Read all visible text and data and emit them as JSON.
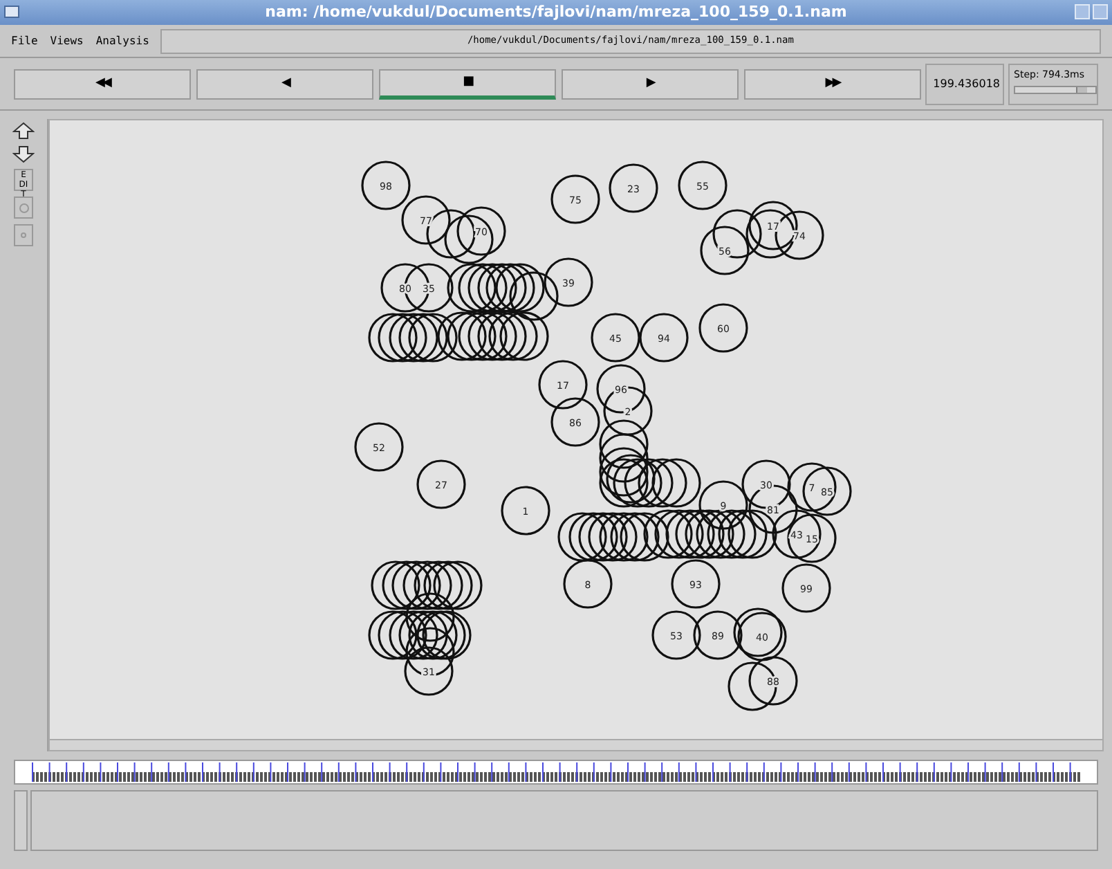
{
  "window": {
    "title": "nam: /home/vukdul/Documents/fajlovi/nam/mreza_100_159_0.1.nam"
  },
  "menu": [
    "File",
    "Views",
    "Analysis"
  ],
  "file_path": "/home/vukdul/Documents/fajlovi/nam/mreza_100_159_0.1.nam",
  "playback_buttons": [
    {
      "label": "◀◀",
      "selected": false
    },
    {
      "label": "◀",
      "selected": false
    },
    {
      "label": "■",
      "selected": true
    },
    {
      "label": "▶",
      "selected": false
    },
    {
      "label": "▶▶",
      "selected": false
    }
  ],
  "step_slider": {
    "level": 0.85
  },
  "time": "199.436018",
  "step": "Step: 794.3ms",
  "toolbar": {
    "edit_label": "EDIT"
  },
  "nodes": [
    {
      "label": "98"
    },
    {
      "label": "77"
    },
    {
      "label": "70"
    },
    {
      "label": "75"
    },
    {
      "label": "23"
    },
    {
      "label": "55"
    },
    {
      "label": "17"
    },
    {
      "label": "74"
    },
    {
      "label": "56"
    },
    {
      "label": "80"
    },
    {
      "label": "35"
    },
    {
      "label": "39"
    },
    {
      "label": "45"
    },
    {
      "label": "94"
    },
    {
      "label": "60"
    },
    {
      "label": "17"
    },
    {
      "label": "96"
    },
    {
      "label": "86"
    },
    {
      "label": "2"
    },
    {
      "label": "52"
    },
    {
      "label": "27"
    },
    {
      "label": "1"
    },
    {
      "label": "9"
    },
    {
      "label": "30"
    },
    {
      "label": "81"
    },
    {
      "label": "7"
    },
    {
      "label": "85"
    },
    {
      "label": "43"
    },
    {
      "label": "15"
    },
    {
      "label": "8"
    },
    {
      "label": "93"
    },
    {
      "label": "99"
    },
    {
      "label": "53"
    },
    {
      "label": "89"
    },
    {
      "label": "40"
    },
    {
      "label": "88"
    },
    {
      "label": "31"
    }
  ]
}
